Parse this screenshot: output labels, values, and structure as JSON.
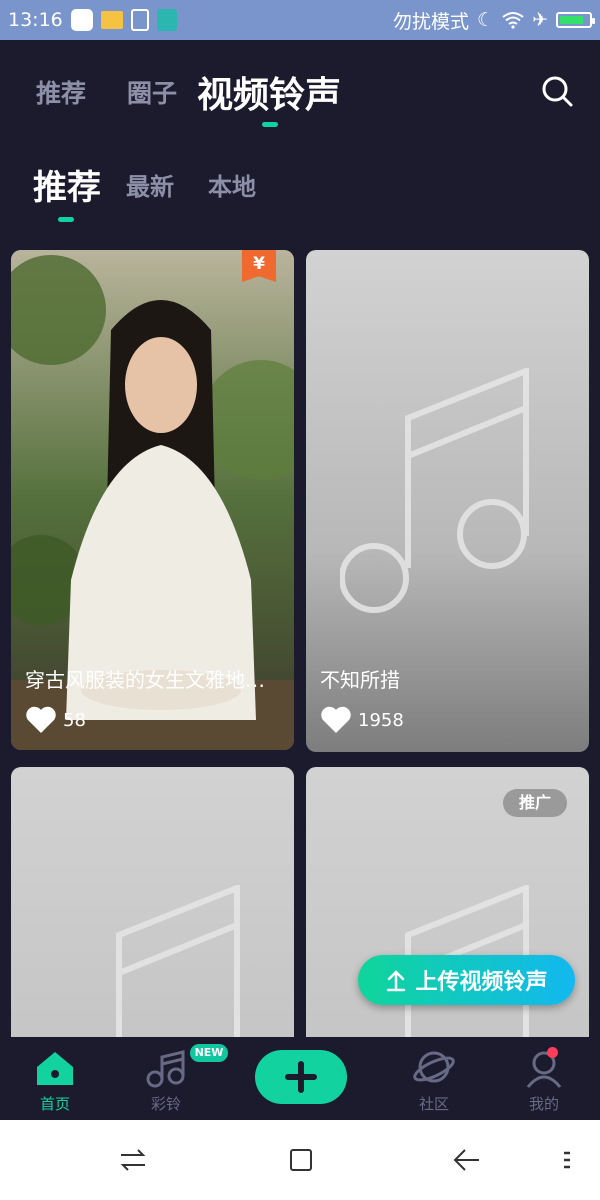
{
  "status_bar": {
    "time": "13:16",
    "dnd_text": "勿扰模式",
    "battery_level": 0.85
  },
  "top_tabs": [
    {
      "label": "推荐"
    },
    {
      "label": "圈子"
    },
    {
      "label": "视频铃声"
    }
  ],
  "sub_tabs": [
    {
      "label": "推荐"
    },
    {
      "label": "最新"
    },
    {
      "label": "本地"
    }
  ],
  "cards": [
    {
      "title": "穿古风服装的女生文雅地在泡茶",
      "likes": "58",
      "badge": "¥"
    },
    {
      "title": "不知所措",
      "likes": "1958"
    },
    {},
    {
      "badge": "推广"
    }
  ],
  "upload_button": {
    "label": "上传视频铃声"
  },
  "bottom_tabs": [
    {
      "label": "首页",
      "icon": "home-icon"
    },
    {
      "label": "彩铃",
      "icon": "music-note-icon",
      "badge": "NEW"
    },
    {
      "label": "",
      "icon": "plus-icon"
    },
    {
      "label": "社区",
      "icon": "planet-icon"
    },
    {
      "label": "我的",
      "icon": "profile-icon"
    }
  ],
  "colors": {
    "accent": "#12d2a0",
    "background": "#1c1b2e",
    "inactive": "#8d8fa8"
  }
}
